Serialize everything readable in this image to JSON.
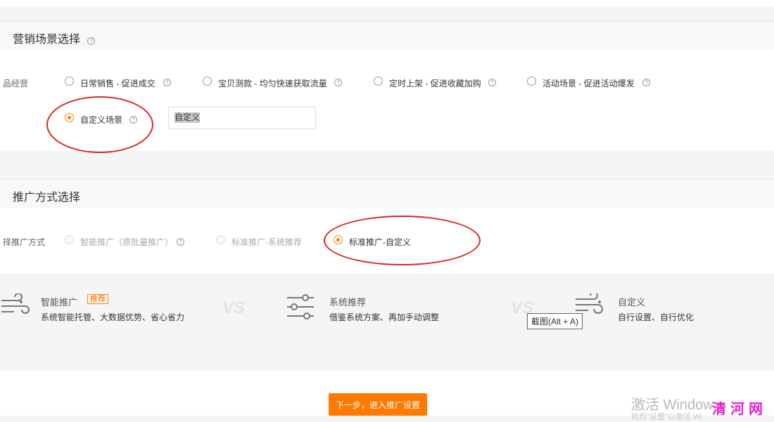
{
  "scene_section": {
    "title": "营销场景选择",
    "row_label": "品经营",
    "options": [
      {
        "label": "日常销售 - 促进成交",
        "checked": false
      },
      {
        "label": "宝贝测款 - 均匀快速获取流量",
        "checked": false
      },
      {
        "label": "定时上架 - 促进收藏加购",
        "checked": false
      },
      {
        "label": "活动场景 - 促进活动爆发",
        "checked": false
      },
      {
        "label": "自定义场景",
        "checked": true
      }
    ],
    "custom_input_value": "自定义"
  },
  "promo_section": {
    "title": "推广方式选择",
    "row_label": "择推广方式",
    "options": [
      {
        "label": "智能推广（原批量推广）",
        "checked": false,
        "disabled": true
      },
      {
        "label": "标准推广-系统推荐",
        "checked": false,
        "disabled": true
      },
      {
        "label": "标准推广-自定义",
        "checked": true,
        "disabled": false
      }
    ]
  },
  "compare": {
    "vs_label": "VS",
    "cards": [
      {
        "title": "智能推广",
        "tag": "推荐",
        "desc": "系统智能托管、大数据优势、省心省力",
        "icon": "wind-icon"
      },
      {
        "title": "系统推荐",
        "desc": "借鉴系统方案、再加手动调整",
        "icon": "sliders-icon"
      },
      {
        "title": "自定义",
        "desc": "自行设置、自行优化",
        "icon": "custom-wind-icon"
      }
    ]
  },
  "tooltip_text": "截图(Alt + A)",
  "next_button": "下一步，进入推广设置",
  "watermark": {
    "line1": "激活 Window",
    "line2": "转到\"设置\"以激活 Wi",
    "site": "清河网"
  },
  "colors": {
    "accent": "#ff7a00",
    "annotation_red": "#e0241b",
    "site_magenta": "#e61fd0"
  }
}
